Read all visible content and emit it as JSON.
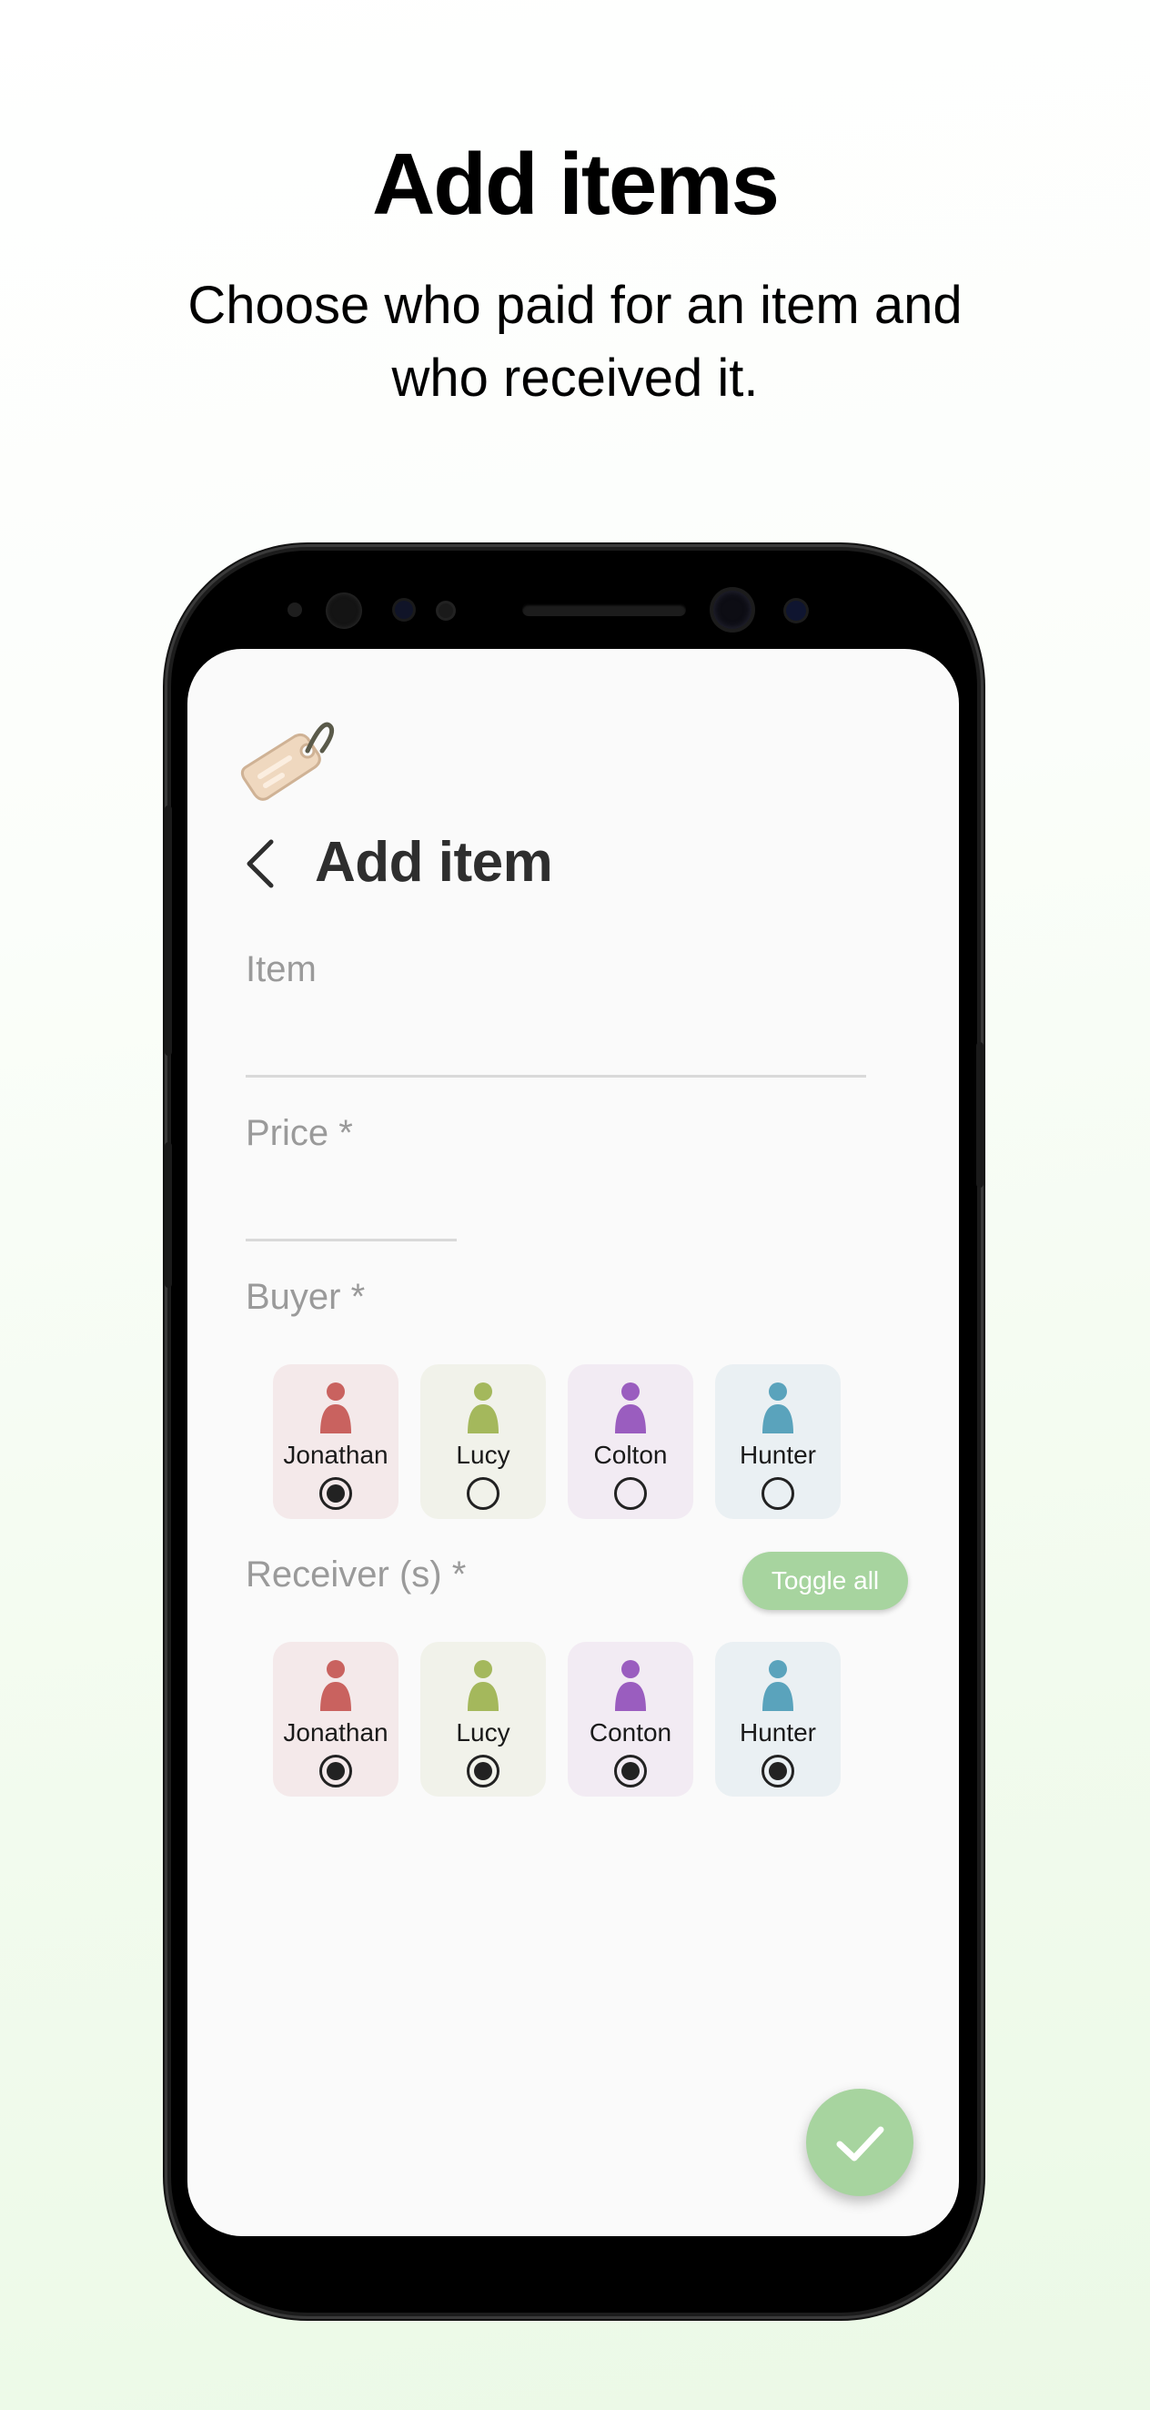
{
  "promo": {
    "title": "Add items",
    "subtitle_line1": "Choose who paid for an item and",
    "subtitle_line2": "who received it."
  },
  "screen": {
    "header": {
      "title": "Add item",
      "icon": "price-tag-icon"
    },
    "fields": {
      "item": {
        "label": "Item",
        "value": ""
      },
      "price": {
        "label": "Price *",
        "value": ""
      }
    },
    "buyer": {
      "label": "Buyer *",
      "people": [
        {
          "name": "Jonathan",
          "selected": true,
          "color": "#c9625f",
          "bg": "#f4e9ea"
        },
        {
          "name": "Lucy",
          "selected": false,
          "color": "#a4b85c",
          "bg": "#f1f2ea"
        },
        {
          "name": "Colton",
          "selected": false,
          "color": "#9a5dbf",
          "bg": "#f2ebf3"
        },
        {
          "name": "Hunter",
          "selected": false,
          "color": "#5aa3bc",
          "bg": "#eaf0f3"
        }
      ]
    },
    "receivers": {
      "label": "Receiver (s) *",
      "toggle_label": "Toggle all",
      "people": [
        {
          "name": "Jonathan",
          "selected": true,
          "color": "#c9625f",
          "bg": "#f4e9ea"
        },
        {
          "name": "Lucy",
          "selected": true,
          "color": "#a4b85c",
          "bg": "#f1f2ea"
        },
        {
          "name": "Conton",
          "selected": true,
          "color": "#9a5dbf",
          "bg": "#f2ebf3"
        },
        {
          "name": "Hunter",
          "selected": true,
          "color": "#5aa3bc",
          "bg": "#eaf0f3"
        }
      ]
    },
    "fab_icon": "check-icon"
  },
  "colors": {
    "accent": "#a7d49f",
    "label_gray": "#9a9a9a",
    "title_dark": "#2e2e2e"
  }
}
